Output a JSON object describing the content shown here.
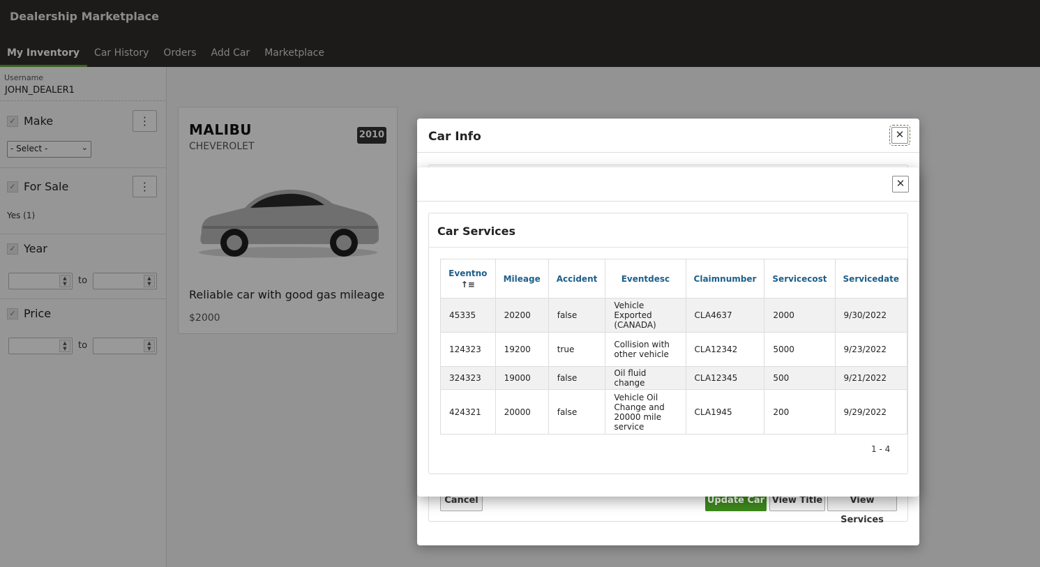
{
  "app": {
    "title": "Dealership Marketplace",
    "tabs": [
      {
        "label": "My Inventory",
        "active": true
      },
      {
        "label": "Car History"
      },
      {
        "label": "Orders"
      },
      {
        "label": "Add Car"
      },
      {
        "label": "Marketplace"
      }
    ]
  },
  "sidebar": {
    "username_label": "Username",
    "username": "JOHN_DEALER1",
    "make": {
      "title": "Make",
      "select": "- Select -"
    },
    "for_sale": {
      "title": "For Sale",
      "item": "Yes (1)"
    },
    "year": {
      "title": "Year",
      "to": "to"
    },
    "price": {
      "title": "Price",
      "to": "to"
    }
  },
  "card": {
    "model": "MALIBU",
    "make": "CHEVEROLET",
    "year": "2010",
    "description": "Reliable car with good gas mileage",
    "price": "$2000"
  },
  "car_info_dialog": {
    "title": "Car Info",
    "buttons": {
      "cancel": "Cancel",
      "update": "Update Car",
      "view_title": "View Title",
      "view_services": "View Services"
    }
  },
  "services_dialog": {
    "title": "Car Services",
    "columns": [
      "Eventno",
      "Mileage",
      "Accident",
      "Eventdesc",
      "Claimnumber",
      "Servicecost",
      "Servicedate"
    ],
    "rows": [
      [
        "45335",
        "20200",
        "false",
        "Vehicle Exported (CANADA)",
        "CLA4637",
        "2000",
        "9/30/2022"
      ],
      [
        "124323",
        "19200",
        "true",
        "Collision with other vehicle",
        "CLA12342",
        "5000",
        "9/23/2022"
      ],
      [
        "324323",
        "19000",
        "false",
        "Oil fluid change",
        "CLA12345",
        "500",
        "9/21/2022"
      ],
      [
        "424321",
        "20000",
        "false",
        "Vehicle Oil Change and 20000 mile service",
        "CLA1945",
        "200",
        "9/29/2022"
      ]
    ],
    "pagination": "1 - 4"
  },
  "colors": {
    "header_bg": "#312d2a",
    "tab_active_underline": "#5fa33b",
    "primary_button": "#3c8a1c",
    "column_header_text": "#1d5f8a"
  }
}
